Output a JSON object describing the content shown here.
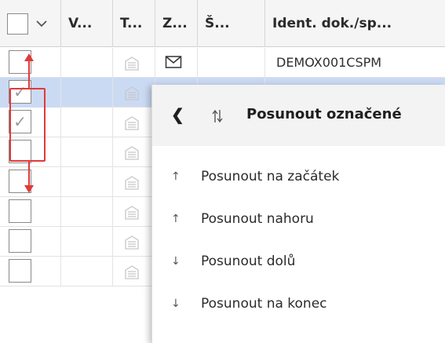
{
  "header": {
    "columns": [
      "V...",
      "T...",
      "Z...",
      "Š...",
      "Ident. dok./sp..."
    ]
  },
  "rows": [
    {
      "selected": false,
      "checked": false,
      "ident": "DEMOX001CSPM"
    },
    {
      "selected": true,
      "checked": true,
      "ident": ""
    },
    {
      "selected": false,
      "checked": true,
      "ident": ""
    },
    {
      "selected": false,
      "checked": false,
      "ident": ""
    },
    {
      "selected": false,
      "checked": false,
      "ident": ""
    },
    {
      "selected": false,
      "checked": false,
      "ident": ""
    },
    {
      "selected": false,
      "checked": false,
      "ident": ""
    },
    {
      "selected": false,
      "checked": false,
      "ident": ""
    }
  ],
  "checkmark_glyph": "✓",
  "menu": {
    "back_glyph": "❮",
    "title": "Posunout označené",
    "items": [
      {
        "arrow": "↑",
        "label": "Posunout na začátek"
      },
      {
        "arrow": "↑",
        "label": "Posunout nahoru"
      },
      {
        "arrow": "↓",
        "label": "Posunout dolů"
      },
      {
        "arrow": "↓",
        "label": "Posunout na konec"
      }
    ]
  },
  "colors": {
    "selected_row": "#cbdaf3",
    "annotation": "#e0393a",
    "header_bg": "#f5f5f5"
  }
}
